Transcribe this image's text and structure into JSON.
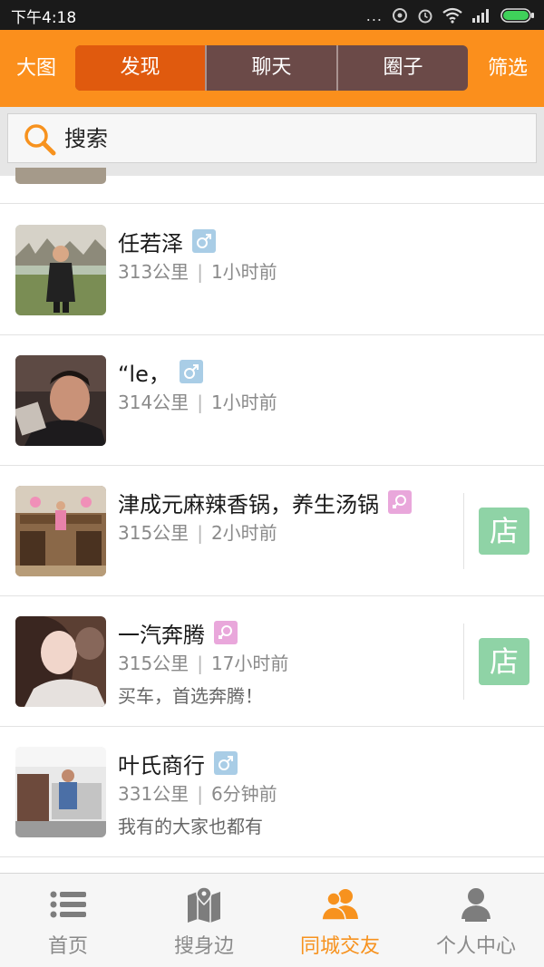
{
  "status_bar": {
    "time": "下午4:18",
    "dots": "..."
  },
  "header": {
    "left_label": "大图",
    "right_label": "筛选",
    "tabs": [
      {
        "label": "发现",
        "active": true
      },
      {
        "label": "聊天",
        "active": false
      },
      {
        "label": "圈子",
        "active": false
      }
    ]
  },
  "search": {
    "placeholder": "搜索",
    "icon": "search-icon"
  },
  "list": {
    "items": [
      {
        "name": "任若泽",
        "gender": "male",
        "distance": "313公里",
        "time": "1小时前",
        "desc": "",
        "shop": ""
      },
      {
        "name": "“le，",
        "gender": "male",
        "distance": "314公里",
        "time": "1小时前",
        "desc": "",
        "shop": ""
      },
      {
        "name": "津成元麻辣香锅，养生汤锅",
        "gender": "female",
        "distance": "315公里",
        "time": "2小时前",
        "desc": "",
        "shop": "店"
      },
      {
        "name": "一汽奔腾",
        "gender": "female",
        "distance": "315公里",
        "time": "17小时前",
        "desc": "买车，首选奔腾！",
        "shop": "店"
      },
      {
        "name": "叶氏商行",
        "gender": "male",
        "distance": "331公里",
        "time": "6分钟前",
        "desc": "我有的大家也都有",
        "shop": ""
      }
    ],
    "separator": "|"
  },
  "bottom_nav": {
    "items": [
      {
        "label": "首页",
        "icon": "list-icon",
        "active": false
      },
      {
        "label": "搜身边",
        "icon": "map-icon",
        "active": false
      },
      {
        "label": "同城交友",
        "icon": "people-icon",
        "active": true
      },
      {
        "label": "个人中心",
        "icon": "person-icon",
        "active": false
      }
    ]
  },
  "colors": {
    "header_bg": "#fb8f1c",
    "tab_active": "#e05a0e",
    "tab_inactive": "#6b4a48",
    "male_badge": "#a9cde6",
    "female_badge": "#e9a7db",
    "shop_badge": "#8fd3a6",
    "nav_active": "#f7921e"
  }
}
